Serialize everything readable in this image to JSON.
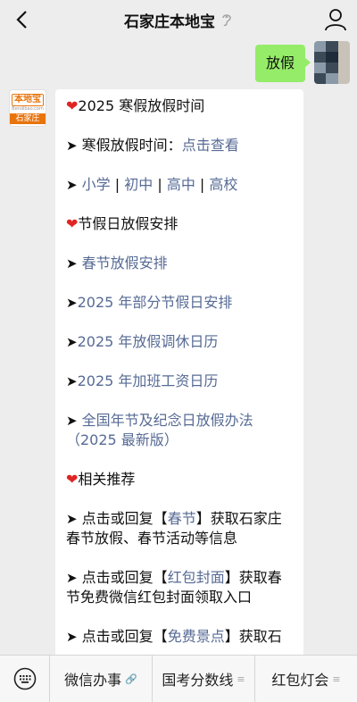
{
  "nav": {
    "title": "石家庄本地宝",
    "back_icon": "back-arrow-icon",
    "ear_icon": "ear-icon",
    "user_icon": "user-icon"
  },
  "sent": {
    "text": "放假"
  },
  "recv": {
    "avatar": {
      "logo_top": "本地宝",
      "logo_tiny": "Bendibao.com",
      "logo_bottom": "石家庄"
    },
    "lines": {
      "l1": "2025 寒假放假时间",
      "l2_prefix": "寒假放假时间：",
      "l2_link": "点击查看",
      "l3_a": "小学",
      "l3_sep1": " | ",
      "l3_b": "初中",
      "l3_sep2": " | ",
      "l3_c": "高中",
      "l3_sep3": " | ",
      "l3_d": "高校",
      "l4": "节假日放假安排",
      "l5": "春节放假安排",
      "l6": "2025 年部分节假日安排",
      "l7": "2025 年放假调休日历",
      "l8": "2025 年加班工资日历",
      "l9a": "全国年节及纪念日放假办法",
      "l9b": "（2025 最新版）",
      "l10": "相关推荐",
      "l11_pre": "点击或回复【",
      "l11_link": "春节",
      "l11_post": "】获取石家庄",
      "l11_b": "春节放假、春节活动等信息",
      "l12_pre": "点击或回复【",
      "l12_link": "红包封面",
      "l12_post": "】获取春",
      "l12_b": "节免费微信红包封面领取入口",
      "l13_pre": "点击或回复【",
      "l13_link": "免费景点",
      "l13_post": "】获取石"
    }
  },
  "menu": {
    "items": [
      {
        "label": "微信办事",
        "suffix": "🔗"
      },
      {
        "label": "国考分数线",
        "suffix": "≡"
      },
      {
        "label": "红包灯会",
        "suffix": "≡"
      }
    ]
  },
  "colors": {
    "link": "#576b95",
    "sent_bubble": "#95ec69",
    "heart": "#e02424",
    "background": "#ededed"
  }
}
